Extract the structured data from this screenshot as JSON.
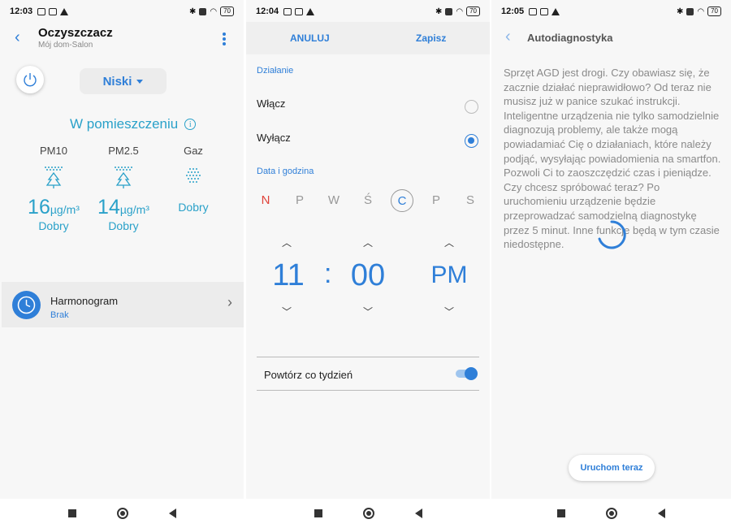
{
  "panel1": {
    "status": {
      "time": "12:03",
      "battery": "70"
    },
    "title": "Oczyszczacz",
    "subtitle": "Mój dom-Salon",
    "mode": "Niski",
    "room_title": "W pomieszczeniu",
    "metrics": [
      {
        "label": "PM10",
        "value": "16",
        "unit": "µg/m³",
        "status": "Dobry"
      },
      {
        "label": "PM2.5",
        "value": "14",
        "unit": "µg/m³",
        "status": "Dobry"
      },
      {
        "label": "Gaz",
        "value": "",
        "unit": "",
        "status": "Dobry"
      }
    ],
    "schedule": {
      "title": "Harmonogram",
      "subtitle": "Brak"
    }
  },
  "panel2": {
    "status": {
      "time": "12:04",
      "battery": "70"
    },
    "cancel": "ANULUJ",
    "save": "Zapisz",
    "action_section": "Działanie",
    "options": [
      {
        "label": "Włącz",
        "selected": false
      },
      {
        "label": "Wyłącz",
        "selected": true
      }
    ],
    "datetime_section": "Data i godzina",
    "days": [
      "N",
      "P",
      "W",
      "Ś",
      "C",
      "P",
      "S"
    ],
    "selected_day": "C",
    "hour": "11",
    "separator": ":",
    "minute": "00",
    "ampm": "PM",
    "repeat_label": "Powtórz co tydzień",
    "repeat_on": true
  },
  "panel3": {
    "status": {
      "time": "12:05",
      "battery": "70"
    },
    "title": "Autodiagnostyka",
    "body": "Sprzęt AGD jest drogi. Czy obawiasz się, że zacznie działać nieprawidłowo? Od teraz nie musisz już w panice szukać instrukcji. Inteligentne urządzenia nie tylko samodzielnie diagnozują problemy, ale także mogą powiadamiać Cię o działaniach, które należy podjąć, wysyłając powiadomienia na smartfon. Pozwoli Ci to zaoszczędzić czas i pieniądze. Czy chcesz spróbować teraz? Po uruchomieniu urządzenie będzie przeprowadzać samodzielną diagnostykę przez 5 minut. Inne funkcje będą w tym czasie niedostępne.",
    "run_button": "Uruchom teraz"
  },
  "colors": {
    "accent": "#2f7fd8",
    "teal": "#2aa1c9",
    "sunday": "#e0433a"
  }
}
